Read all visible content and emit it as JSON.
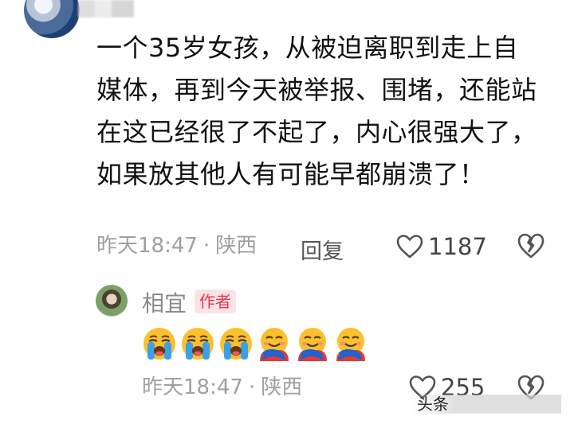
{
  "comment": {
    "text": "一个35岁女孩，从被迫离职到走上自媒体，再到今天被举报、围堵，还能站在这已经很了不起了，内心很强大了，如果放其他人有可能早都崩溃了！",
    "time": "昨天18:47",
    "separator": "·",
    "location": "陕西",
    "reply_label": "回复",
    "like_count": "1187"
  },
  "reply": {
    "author_name": "相宜",
    "author_badge": "作者",
    "emojis": [
      "loudly-crying-face",
      "loudly-crying-face",
      "loudly-crying-face",
      "hugging-face",
      "hugging-face",
      "hugging-face"
    ],
    "time": "昨天18:47",
    "separator": "·",
    "location": "陕西",
    "like_count": "255"
  },
  "watermark": {
    "text": "头条"
  },
  "colors": {
    "meta_gray": "#a0a0a0",
    "badge_bg": "#fbe3e5",
    "badge_text": "#e33a4a"
  }
}
